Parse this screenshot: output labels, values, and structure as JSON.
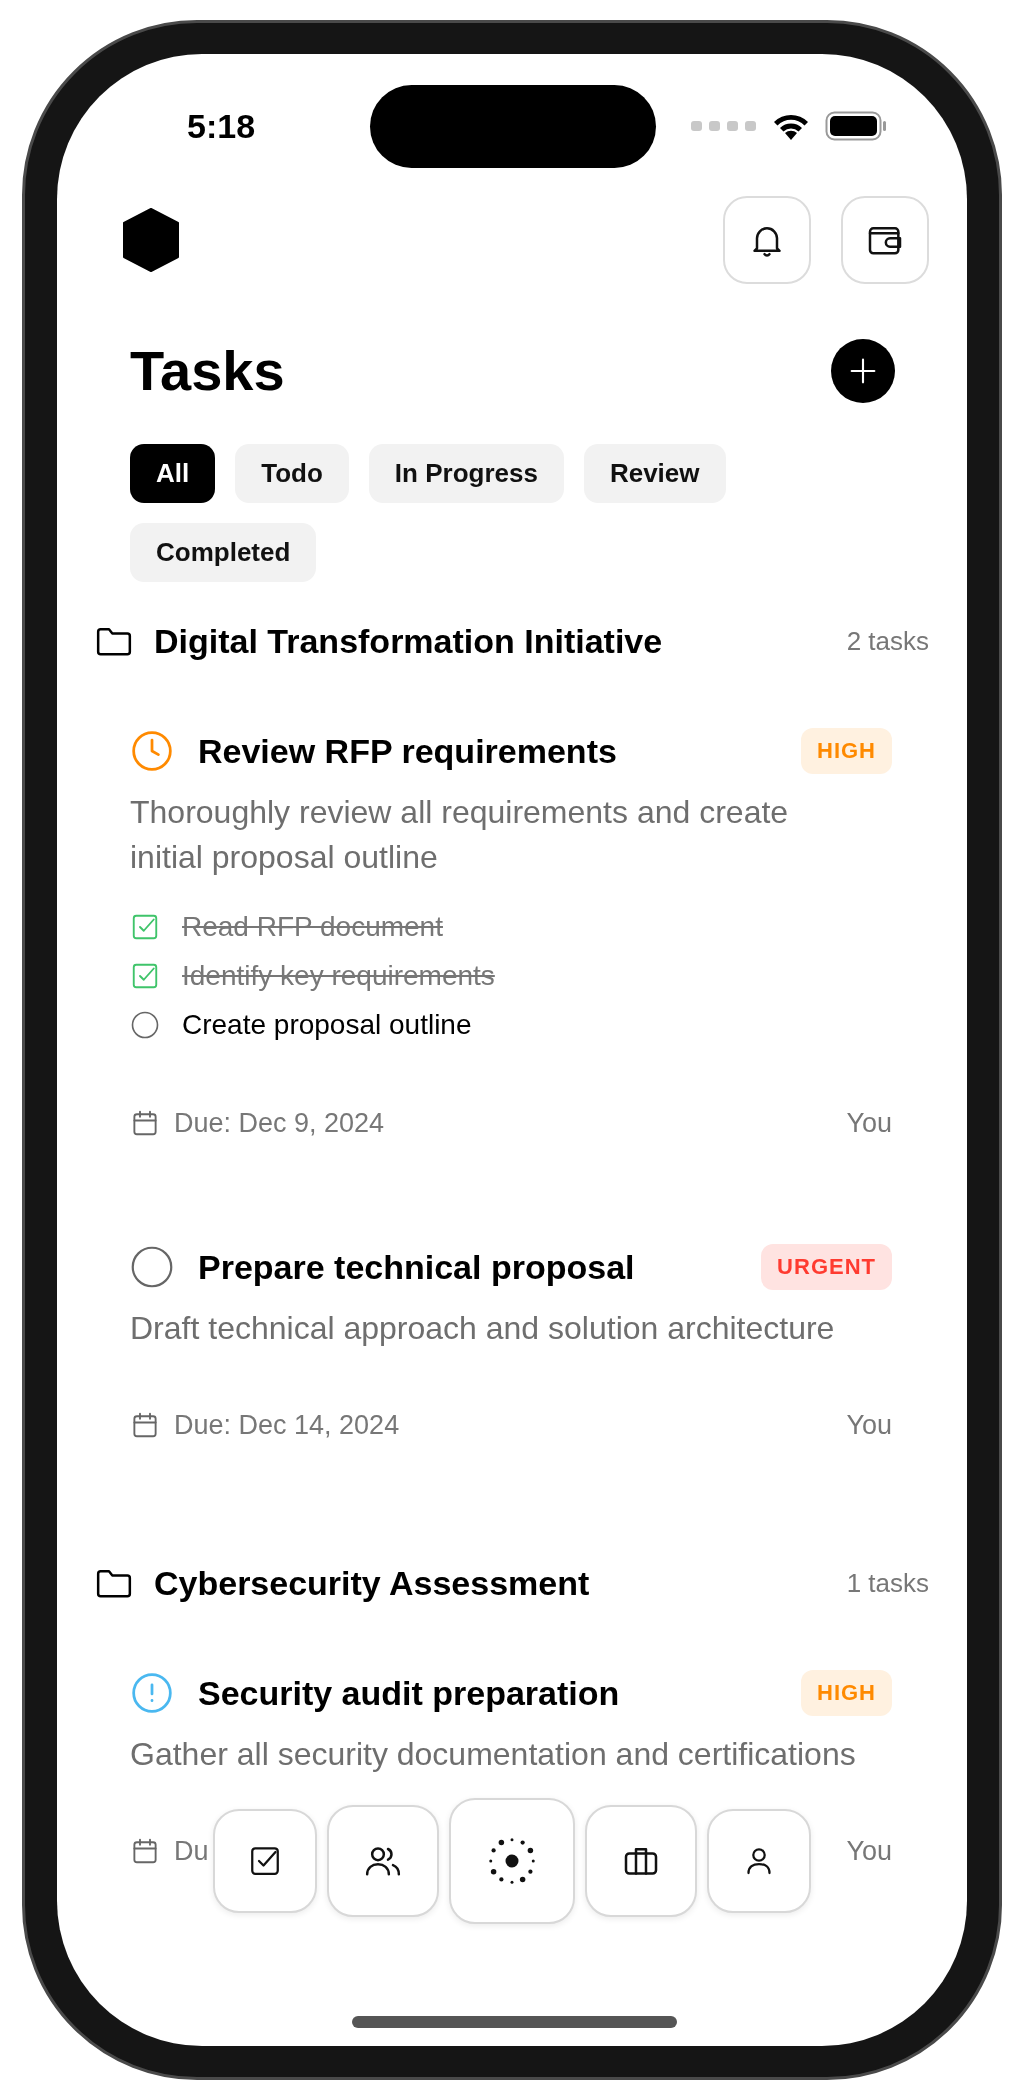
{
  "status_bar": {
    "time": "5:18"
  },
  "title": "Tasks",
  "filters": [
    {
      "label": "All",
      "selected": true
    },
    {
      "label": "Todo",
      "selected": false
    },
    {
      "label": "In Progress",
      "selected": false
    },
    {
      "label": "Review",
      "selected": false
    },
    {
      "label": "Completed",
      "selected": false
    }
  ],
  "projects": [
    {
      "name": "Digital Transformation Initiative",
      "count": "2 tasks",
      "tasks": [
        {
          "kind": "in_progress",
          "title": "Review RFP requirements",
          "priority": {
            "label": "HIGH",
            "kind": "high"
          },
          "description": "Thoroughly review all requirements and create initial proposal outline",
          "subtasks": [
            {
              "label": "Read RFP document",
              "checked": true
            },
            {
              "label": "Identify key requirements",
              "checked": true
            },
            {
              "label": "Create proposal outline",
              "checked": false
            }
          ],
          "due": "Due: Dec 9, 2024",
          "assignee": "You"
        },
        {
          "kind": "todo",
          "title": "Prepare technical proposal",
          "priority": {
            "label": "URGENT",
            "kind": "urgent"
          },
          "description": "Draft technical approach and solution architecture",
          "due": "Due: Dec 14, 2024",
          "assignee": "You"
        }
      ]
    },
    {
      "name": "Cybersecurity Assessment",
      "count": "1 tasks",
      "tasks": [
        {
          "kind": "review",
          "title": "Security audit preparation",
          "priority": {
            "label": "HIGH",
            "kind": "high"
          },
          "description": "Gather all security documentation and certifications",
          "due": "Du",
          "assignee": "You"
        }
      ]
    }
  ],
  "tab_bar": [
    {
      "kind": "tasks"
    },
    {
      "kind": "team"
    },
    {
      "kind": "hub"
    },
    {
      "kind": "work"
    },
    {
      "kind": "profile"
    }
  ]
}
